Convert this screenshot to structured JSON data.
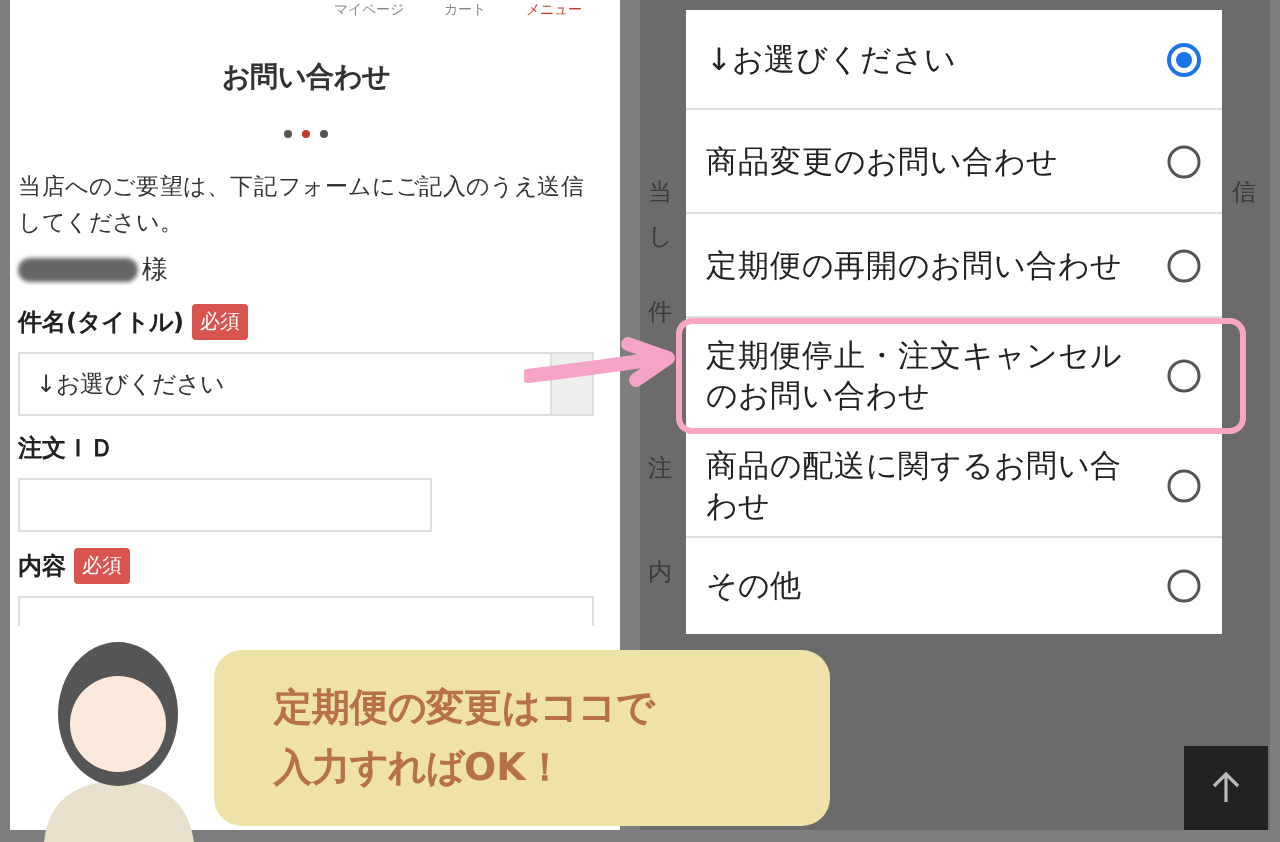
{
  "left_screen": {
    "nav": [
      {
        "label": "マイページ",
        "highlighted": false
      },
      {
        "label": "カート",
        "highlighted": false
      },
      {
        "label": "メニュー",
        "highlighted": true
      }
    ],
    "title": "お問い合わせ",
    "intro": "当店へのご要望は、下記フォームにご記入のうえ送信してください。",
    "name_suffix": "様",
    "fields": [
      {
        "kind": "select",
        "label": "件名(タイトル)",
        "badge": "必須",
        "value": "↓お選びください"
      },
      {
        "kind": "text",
        "label": "注文ＩＤ"
      },
      {
        "kind": "textarea",
        "label": "内容",
        "badge": "必須"
      }
    ]
  },
  "right_screen": {
    "background_fragments": [
      "当",
      "し",
      "件",
      "注",
      "内"
    ],
    "background_fragment_right": "信",
    "options": [
      {
        "label": "↓お選びください",
        "selected": true,
        "highlighted": false
      },
      {
        "label": "商品変更のお問い合わせ",
        "selected": false,
        "highlighted": false
      },
      {
        "label": "定期便の再開のお問い合わせ",
        "selected": false,
        "highlighted": false
      },
      {
        "label": "定期便停止・注文キャンセルのお問い合わせ",
        "selected": false,
        "highlighted": true
      },
      {
        "label": "商品の配送に関するお問い合わせ",
        "selected": false,
        "highlighted": false
      },
      {
        "label": "その他",
        "selected": false,
        "highlighted": false
      }
    ]
  },
  "callout": {
    "lines": [
      "定期便の変更はココで",
      "入力すればOK！"
    ]
  }
}
